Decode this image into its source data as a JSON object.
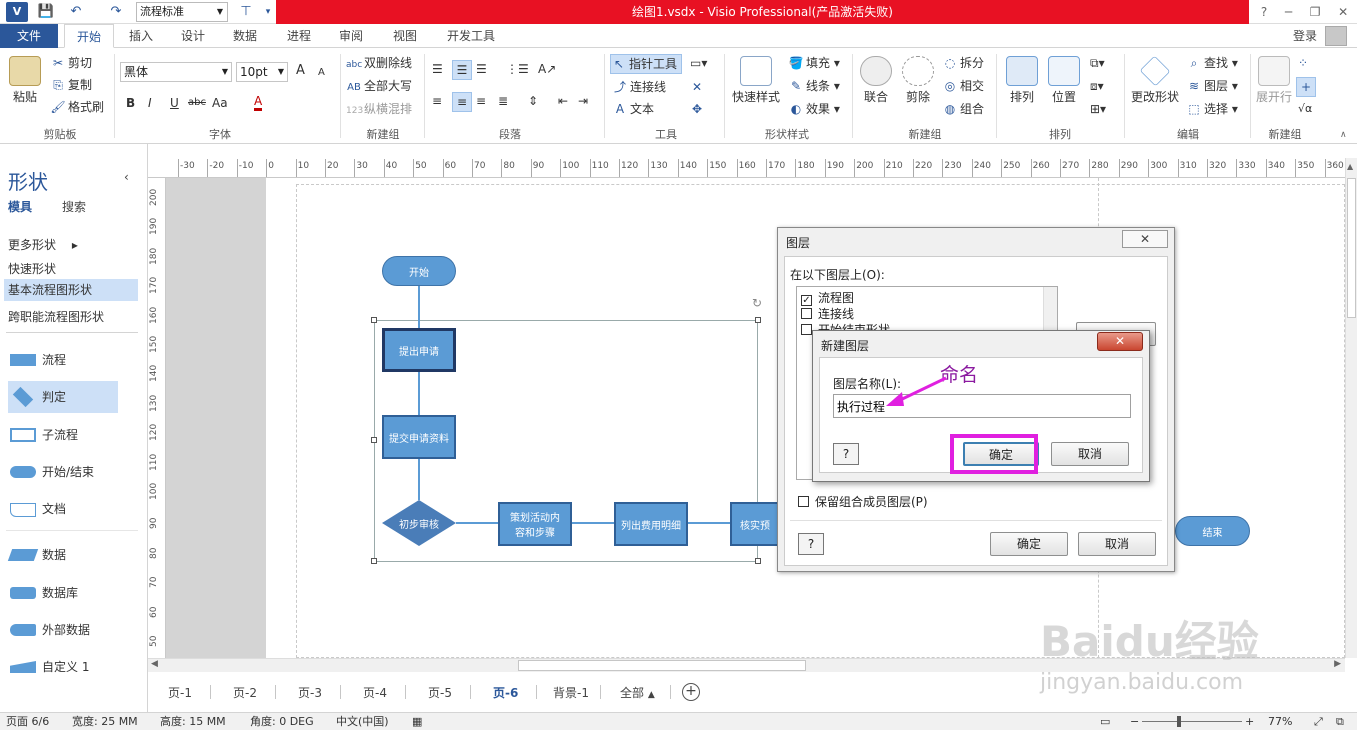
{
  "window": {
    "title": "绘图1.vsdx - Visio Professional(产品激活失败)",
    "style_select": "流程标准",
    "controls": [
      "?",
      "─",
      "❐",
      "✕"
    ]
  },
  "tabs": {
    "file": "文件",
    "items": [
      "开始",
      "插入",
      "设计",
      "数据",
      "进程",
      "审阅",
      "视图",
      "开发工具"
    ],
    "login": "登录"
  },
  "ribbon": {
    "clipboard": {
      "label": "剪贴板",
      "paste": "粘贴",
      "cut": "剪切",
      "copy": "复制",
      "format_painter": "格式刷"
    },
    "font": {
      "label": "字体",
      "family": "黑体",
      "size": "10pt",
      "grow": "A",
      "shrink": "A",
      "bold": "B",
      "italic": "I",
      "underline": "U",
      "strike": "abc",
      "case": "Aa",
      "color": "A"
    },
    "new_group": {
      "label": "新建组",
      "strikethrough": "双删除线",
      "allcaps": "全部大写",
      "vertical": "纵横混排"
    },
    "paragraph": {
      "label": "段落"
    },
    "tools": {
      "label": "工具",
      "pointer": "指针工具",
      "connector": "连接线",
      "text": "文本"
    },
    "shape_styles": {
      "label": "形状样式",
      "quick": "快速样式",
      "fill": "填充",
      "line": "线条",
      "effect": "效果"
    },
    "operations": {
      "label": "新建组",
      "union": "联合",
      "fragment": "剪除",
      "split": "拆分",
      "intersect": "相交",
      "combine": "组合"
    },
    "arrange": {
      "label": "排列",
      "arrange": "排列",
      "position": "位置"
    },
    "edit": {
      "label": "编辑",
      "change_shape": "更改形状",
      "find": "查找",
      "layers": "图层",
      "select": "选择"
    },
    "new_group2": {
      "label": "新建组",
      "expand": "展开行"
    }
  },
  "left_panel": {
    "title": "形状",
    "tabs": [
      "模具",
      "搜索"
    ],
    "links": [
      "更多形状",
      "快速形状",
      "基本流程图形状",
      "跨职能流程图形状"
    ],
    "shapes": [
      "流程",
      "判定",
      "子流程",
      "开始/结束",
      "文档",
      "数据",
      "数据库",
      "外部数据",
      "自定义 1"
    ]
  },
  "ruler": {
    "h": [
      "-30",
      "-20",
      "-10",
      "0",
      "10",
      "20",
      "30",
      "40",
      "50",
      "60",
      "70",
      "80",
      "90",
      "100",
      "110",
      "120",
      "130",
      "140",
      "150",
      "160",
      "170",
      "180",
      "190",
      "200",
      "210",
      "220",
      "230",
      "240",
      "250",
      "260",
      "270",
      "280",
      "290",
      "300",
      "310",
      "320",
      "330",
      "340",
      "350",
      "360"
    ],
    "v": [
      "200",
      "190",
      "180",
      "170",
      "160",
      "150",
      "140",
      "130",
      "120",
      "110",
      "100",
      "90",
      "80",
      "70",
      "60",
      "50"
    ]
  },
  "flowchart": {
    "start": "开始",
    "submit": "提出申请",
    "submit_docs": "提交申请资料",
    "review": "初步审核",
    "plan": "策划活动内容和步骤",
    "costs": "列出费用明细",
    "verify": "核实预",
    "end": "结束"
  },
  "dialog_layers": {
    "title": "图层",
    "close": "✕",
    "on_layer_label": "在以下图层上(O):",
    "layers": [
      {
        "name": "流程图",
        "checked": true
      },
      {
        "name": "连接线",
        "checked": false
      },
      {
        "name": "开始结束形状",
        "checked": false
      }
    ],
    "preserve_label": "保留组合成员图层(P)",
    "ok": "确定",
    "cancel": "取消",
    "help": "?"
  },
  "dialog_new_layer": {
    "title": "新建图层",
    "close": "✕",
    "name_label": "图层名称(L):",
    "name_value": "执行过程",
    "ok": "确定",
    "cancel": "取消",
    "help": "?"
  },
  "annotation": {
    "text": "命名",
    "color": "#e020e0"
  },
  "page_tabs": [
    "页-1",
    "页-2",
    "页-3",
    "页-4",
    "页-5",
    "页-6",
    "背景-1",
    "全部"
  ],
  "status": {
    "page": "页面 6/6",
    "width": "宽度: 25 MM",
    "height": "高度: 15 MM",
    "angle": "角度: 0 DEG",
    "lang": "中文(中国)",
    "zoom": "77%"
  },
  "watermark": {
    "line1": "Baidu经验",
    "line2": "jingyan.baidu.com"
  },
  "colors": {
    "brand": "#2b579a",
    "title_red": "#e81123",
    "shape_fill": "#5b9bd5"
  }
}
